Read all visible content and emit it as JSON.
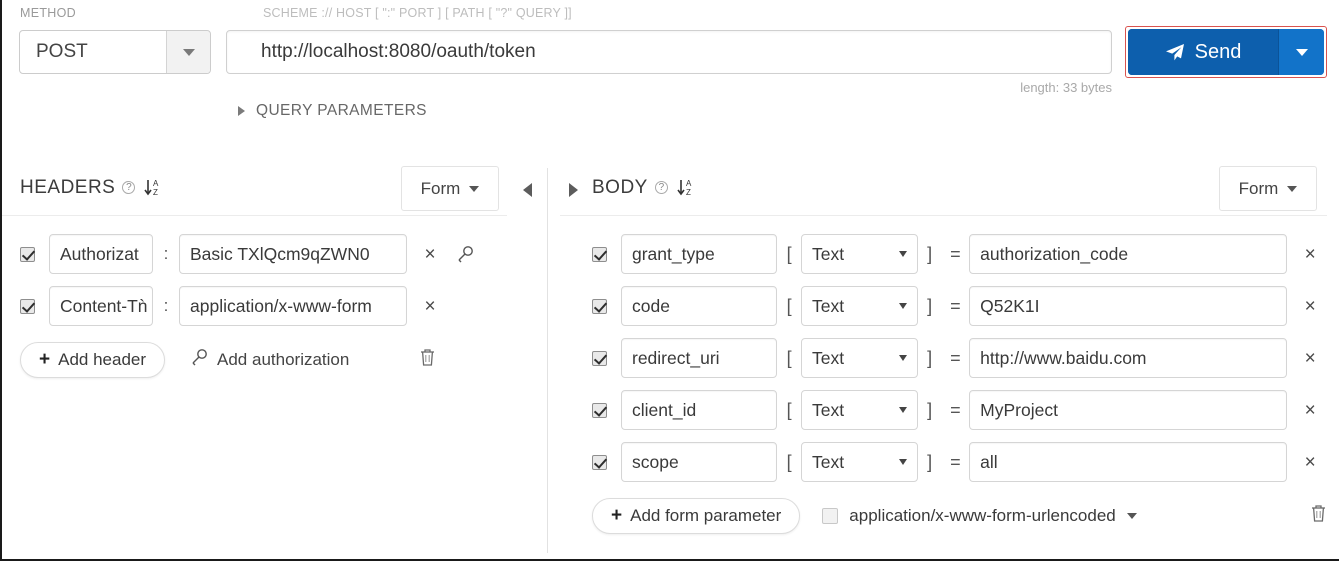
{
  "request": {
    "method_label": "METHOD",
    "scheme_label": "SCHEME :// HOST [ \":\" PORT ] [ PATH [ \"?\" QUERY ]]",
    "method_value": "POST",
    "url_value": "http://localhost:8080/oauth/token",
    "send_label": "Send",
    "length_note": "length: 33 bytes",
    "query_parameters_label": "QUERY PARAMETERS",
    "accent_color": "#0d5fad",
    "highlight_color": "#d9534f"
  },
  "headers_panel": {
    "title": "HEADERS",
    "help_glyph": "?",
    "view_mode": "Form",
    "rows": [
      {
        "name": "Authorizat",
        "colon": ":",
        "value": "Basic TXlQcm9qZWN0",
        "remove": "×",
        "has_key_icon": true
      },
      {
        "name": "Content-Tǹ",
        "colon": ":",
        "value": "application/x-www-form",
        "remove": "×",
        "has_key_icon": false
      }
    ],
    "add_header_label": "Add header",
    "add_header_plus": "+",
    "add_authorization_label": "Add authorization"
  },
  "body_panel": {
    "title": "BODY",
    "help_glyph": "?",
    "view_mode": "Form",
    "bracket_open": "[",
    "bracket_close": "]",
    "equals": "=",
    "rows": [
      {
        "name": "grant_type",
        "type": "Text",
        "value": "authorization_code",
        "remove": "×"
      },
      {
        "name": "code",
        "type": "Text",
        "value": "Q52K1I",
        "remove": "×"
      },
      {
        "name": "redirect_uri",
        "type": "Text",
        "value": "http://www.baidu.com",
        "remove": "×"
      },
      {
        "name": "client_id",
        "type": "Text",
        "value": "MyProject",
        "remove": "×"
      },
      {
        "name": "scope",
        "type": "Text",
        "value": "all",
        "remove": "×"
      }
    ],
    "add_form_parameter_label": "Add form parameter",
    "add_form_parameter_plus": "+",
    "encoding_label": "application/x-www-form-urlencoded"
  }
}
